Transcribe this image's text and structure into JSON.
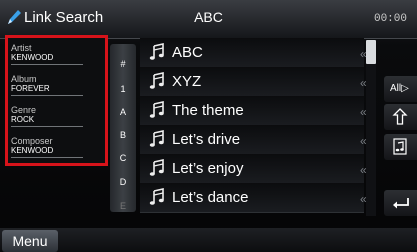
{
  "header": {
    "app_title": "Link Search",
    "now_playing": "ABC",
    "clock": "00:00"
  },
  "info_panel": {
    "items": [
      {
        "key": "Artist",
        "value": "KENWOOD"
      },
      {
        "key": "Album",
        "value": "FOREVER"
      },
      {
        "key": "Genre",
        "value": "ROCK"
      },
      {
        "key": "Composer",
        "value": "KENWOOD"
      }
    ],
    "highlight_color": "#d6131a"
  },
  "index_bar": [
    "#",
    "1",
    "A",
    "B",
    "C",
    "D",
    "E"
  ],
  "list": {
    "rows": [
      {
        "title": "ABC"
      },
      {
        "title": "XYZ"
      },
      {
        "title": "The theme"
      },
      {
        "title": "Let’s drive"
      },
      {
        "title": "Let’s enjoy"
      },
      {
        "title": "Let’s dance"
      }
    ],
    "row_icon": "music-note-icon",
    "row_chevron": "«"
  },
  "side_buttons": {
    "all_label": "All▷",
    "up_icon": "up-arrow-icon",
    "folder_icon": "music-folder-icon",
    "back_icon": "return-arrow-icon"
  },
  "footer": {
    "menu_label": "Menu"
  }
}
